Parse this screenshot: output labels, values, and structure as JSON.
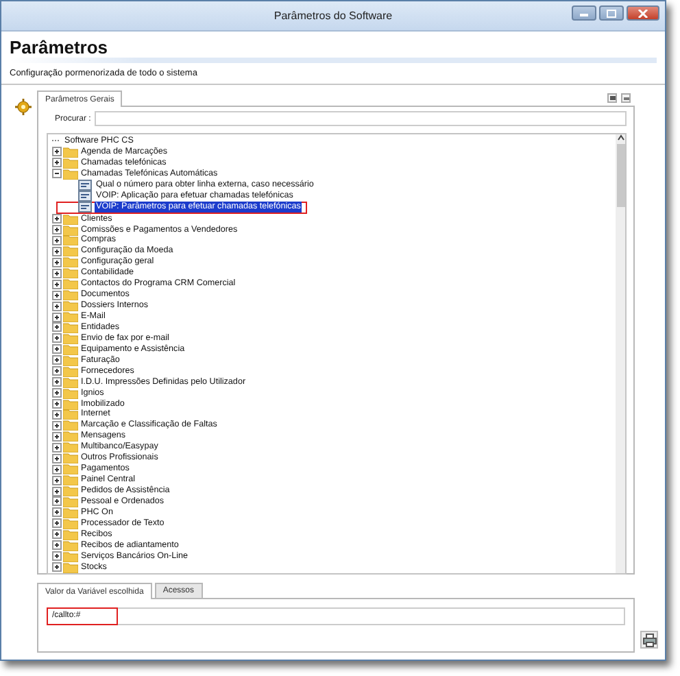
{
  "window": {
    "title": "Parâmetros do Software"
  },
  "header": {
    "title": "Parâmetros",
    "subtitle": "Configuração pormenorizada de todo o sistema"
  },
  "top_tabs": [
    {
      "label": "Parâmetros Gerais",
      "selected": true
    }
  ],
  "search": {
    "label": "Procurar :"
  },
  "tree": {
    "label": "Software PHC CS",
    "children": [
      {
        "kind": "folder",
        "label": "Agenda de Marcações",
        "expanded": false,
        "selected": false
      },
      {
        "kind": "folder",
        "label": "Chamadas telefónicas",
        "expanded": false,
        "selected": false
      },
      {
        "kind": "folder",
        "label": "Chamadas Telefónicas Automáticas",
        "expanded": true,
        "selected": false,
        "children": [
          {
            "kind": "param",
            "label": "Qual o número para obter linha externa, caso necessário",
            "selected": false,
            "highlighted": false
          },
          {
            "kind": "param",
            "label": "VOIP: Aplicação para efetuar chamadas telefónicas",
            "selected": false,
            "highlighted": false
          },
          {
            "kind": "param",
            "label": "VOIP: Parâmetros para efetuar chamadas telefónicas",
            "selected": true,
            "highlighted": true
          }
        ]
      },
      {
        "kind": "folder",
        "label": "Clientes",
        "expanded": false,
        "selected": false
      },
      {
        "kind": "folder",
        "label": "Comissões e Pagamentos a Vendedores",
        "expanded": false,
        "selected": false
      },
      {
        "kind": "folder",
        "label": "Compras",
        "expanded": false,
        "selected": false
      },
      {
        "kind": "folder",
        "label": "Configuração da Moeda",
        "expanded": false,
        "selected": false
      },
      {
        "kind": "folder",
        "label": "Configuração geral",
        "expanded": false,
        "selected": false
      },
      {
        "kind": "folder",
        "label": "Contabilidade",
        "expanded": false,
        "selected": false
      },
      {
        "kind": "folder",
        "label": "Contactos do Programa CRM Comercial",
        "expanded": false,
        "selected": false
      },
      {
        "kind": "folder",
        "label": "Documentos",
        "expanded": false,
        "selected": false
      },
      {
        "kind": "folder",
        "label": "Dossiers Internos",
        "expanded": false,
        "selected": false
      },
      {
        "kind": "folder",
        "label": "E-Mail",
        "expanded": false,
        "selected": false
      },
      {
        "kind": "folder",
        "label": "Entidades",
        "expanded": false,
        "selected": false
      },
      {
        "kind": "folder",
        "label": "Envio de fax por e-mail",
        "expanded": false,
        "selected": false
      },
      {
        "kind": "folder",
        "label": "Equipamento e Assistência",
        "expanded": false,
        "selected": false
      },
      {
        "kind": "folder",
        "label": "Faturação",
        "expanded": false,
        "selected": false
      },
      {
        "kind": "folder",
        "label": "Fornecedores",
        "expanded": false,
        "selected": false
      },
      {
        "kind": "folder",
        "label": "I.D.U. Impressões Definidas pelo Utilizador",
        "expanded": false,
        "selected": false
      },
      {
        "kind": "folder",
        "label": "Ignios",
        "expanded": false,
        "selected": false
      },
      {
        "kind": "folder",
        "label": "Imobilizado",
        "expanded": false,
        "selected": false
      },
      {
        "kind": "folder",
        "label": "Internet",
        "expanded": false,
        "selected": false
      },
      {
        "kind": "folder",
        "label": "Marcação e Classificação de Faltas",
        "expanded": false,
        "selected": false
      },
      {
        "kind": "folder",
        "label": "Mensagens",
        "expanded": false,
        "selected": false
      },
      {
        "kind": "folder",
        "label": "Multibanco/Easypay",
        "expanded": false,
        "selected": false
      },
      {
        "kind": "folder",
        "label": "Outros Profissionais",
        "expanded": false,
        "selected": false
      },
      {
        "kind": "folder",
        "label": "Pagamentos",
        "expanded": false,
        "selected": false
      },
      {
        "kind": "folder",
        "label": "Painel Central",
        "expanded": false,
        "selected": false
      },
      {
        "kind": "folder",
        "label": "Pedidos de Assistência",
        "expanded": false,
        "selected": false
      },
      {
        "kind": "folder",
        "label": "Pessoal e Ordenados",
        "expanded": false,
        "selected": false
      },
      {
        "kind": "folder",
        "label": "PHC On",
        "expanded": false,
        "selected": false
      },
      {
        "kind": "folder",
        "label": "Processador de Texto",
        "expanded": false,
        "selected": false
      },
      {
        "kind": "folder",
        "label": "Recibos",
        "expanded": false,
        "selected": false
      },
      {
        "kind": "folder",
        "label": "Recibos de adiantamento",
        "expanded": false,
        "selected": false
      },
      {
        "kind": "folder",
        "label": "Serviços Bancários On-Line",
        "expanded": false,
        "selected": false
      },
      {
        "kind": "folder",
        "label": "Stocks",
        "expanded": false,
        "selected": false
      }
    ]
  },
  "bottom_tabs": [
    {
      "label": "Valor da Variável escolhida",
      "selected": true
    },
    {
      "label": "Acessos",
      "selected": false
    }
  ],
  "value_field": {
    "value": "/callto:#",
    "highlighted": true
  }
}
